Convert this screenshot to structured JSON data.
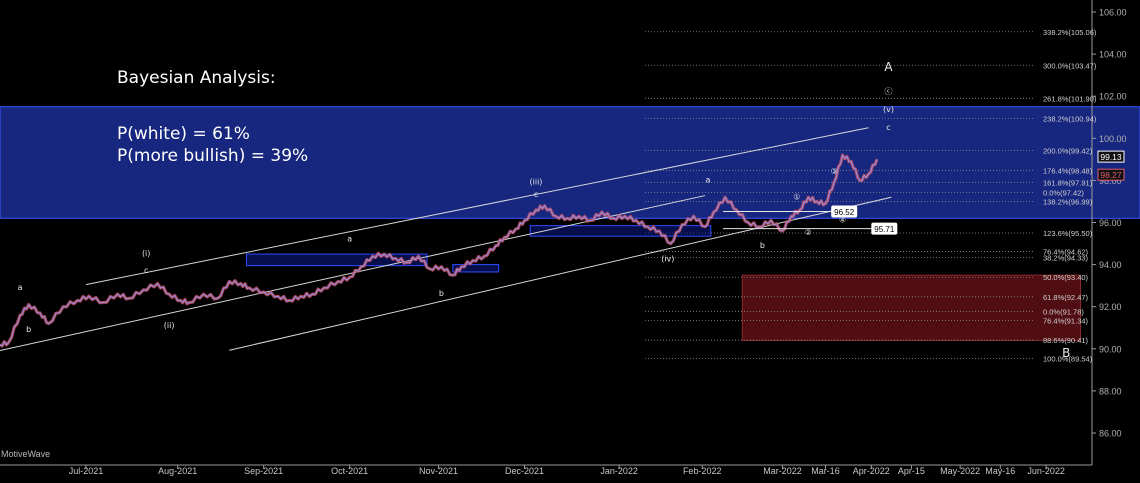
{
  "analysis": {
    "title": "Bayesian Analysis:",
    "p_white": "P(white) = 61%",
    "p_bullish": "P(more bullish) = 39%"
  },
  "watermark": "MotiveWave",
  "chart_data": {
    "type": "line",
    "title": "",
    "x_start": "2021-06-01",
    "x_end": "2022-06-17",
    "x_ticks": [
      {
        "label": "Jul-2021",
        "date": "2021-07-01"
      },
      {
        "label": "Aug-2021",
        "date": "2021-08-02"
      },
      {
        "label": "Sep-2021",
        "date": "2021-09-01"
      },
      {
        "label": "Oct-2021",
        "date": "2021-10-01"
      },
      {
        "label": "Nov-2021",
        "date": "2021-11-01"
      },
      {
        "label": "Dec-2021",
        "date": "2021-12-01"
      },
      {
        "label": "Jan-2022",
        "date": "2022-01-03"
      },
      {
        "label": "Feb-2022",
        "date": "2022-02-01"
      },
      {
        "label": "Mar-2022",
        "date": "2022-03-01"
      },
      {
        "label": "Mar-16",
        "date": "2022-03-16"
      },
      {
        "label": "Apr-2022",
        "date": "2022-04-01"
      },
      {
        "label": "Apr-15",
        "date": "2022-04-15"
      },
      {
        "label": "May-2022",
        "date": "2022-05-02"
      },
      {
        "label": "May-16",
        "date": "2022-05-16"
      },
      {
        "label": "Jun-2022",
        "date": "2022-06-01"
      }
    ],
    "y_ticks": [
      "106.00",
      "104.00",
      "102.00",
      "100.00",
      "98.00",
      "96.00",
      "94.00",
      "92.00",
      "90.00",
      "88.00",
      "86.00"
    ],
    "ylim": [
      85.0,
      106.4
    ],
    "grid": false,
    "price_series": [
      [
        "2021-06-01",
        90.2
      ],
      [
        "2021-06-04",
        90.3
      ],
      [
        "2021-06-08",
        91.6
      ],
      [
        "2021-06-11",
        92.1
      ],
      [
        "2021-06-15",
        91.7
      ],
      [
        "2021-06-18",
        91.2
      ],
      [
        "2021-06-23",
        92.0
      ],
      [
        "2021-06-28",
        92.3
      ],
      [
        "2021-07-02",
        92.5
      ],
      [
        "2021-07-07",
        92.2
      ],
      [
        "2021-07-12",
        92.6
      ],
      [
        "2021-07-16",
        92.4
      ],
      [
        "2021-07-21",
        92.8
      ],
      [
        "2021-07-26",
        93.1
      ],
      [
        "2021-07-30",
        92.6
      ],
      [
        "2021-08-03",
        92.3
      ],
      [
        "2021-08-06",
        92.2
      ],
      [
        "2021-08-11",
        92.6
      ],
      [
        "2021-08-16",
        92.4
      ],
      [
        "2021-08-20",
        93.2
      ],
      [
        "2021-08-24",
        93.1
      ],
      [
        "2021-08-27",
        92.9
      ],
      [
        "2021-09-01",
        92.7
      ],
      [
        "2021-09-06",
        92.5
      ],
      [
        "2021-09-10",
        92.3
      ],
      [
        "2021-09-14",
        92.5
      ],
      [
        "2021-09-18",
        92.6
      ],
      [
        "2021-09-22",
        92.9
      ],
      [
        "2021-09-27",
        93.2
      ],
      [
        "2021-10-01",
        93.4
      ],
      [
        "2021-10-05",
        93.9
      ],
      [
        "2021-10-09",
        94.4
      ],
      [
        "2021-10-13",
        94.5
      ],
      [
        "2021-10-17",
        94.3
      ],
      [
        "2021-10-21",
        94.1
      ],
      [
        "2021-10-25",
        94.4
      ],
      [
        "2021-10-29",
        93.8
      ],
      [
        "2021-11-02",
        93.9
      ],
      [
        "2021-11-06",
        93.5
      ],
      [
        "2021-11-09",
        93.9
      ],
      [
        "2021-11-13",
        94.2
      ],
      [
        "2021-11-17",
        94.4
      ],
      [
        "2021-11-21",
        94.9
      ],
      [
        "2021-11-24",
        95.3
      ],
      [
        "2021-11-28",
        95.7
      ],
      [
        "2021-12-01",
        96.1
      ],
      [
        "2021-12-05",
        96.6
      ],
      [
        "2021-12-08",
        96.8
      ],
      [
        "2021-12-12",
        96.3
      ],
      [
        "2021-12-16",
        96.2
      ],
      [
        "2021-12-20",
        96.3
      ],
      [
        "2021-12-24",
        96.1
      ],
      [
        "2021-12-28",
        96.5
      ],
      [
        "2022-01-01",
        96.2
      ],
      [
        "2022-01-05",
        96.3
      ],
      [
        "2022-01-09",
        96.1
      ],
      [
        "2022-01-13",
        95.8
      ],
      [
        "2022-01-17",
        95.6
      ],
      [
        "2022-01-21",
        95.0
      ],
      [
        "2022-01-25",
        95.9
      ],
      [
        "2022-01-29",
        96.3
      ],
      [
        "2022-02-02",
        95.8
      ],
      [
        "2022-02-05",
        96.5
      ],
      [
        "2022-02-09",
        97.2
      ],
      [
        "2022-02-13",
        96.6
      ],
      [
        "2022-02-17",
        96.0
      ],
      [
        "2022-02-21",
        95.8
      ],
      [
        "2022-02-25",
        96.1
      ],
      [
        "2022-03-01",
        95.6
      ],
      [
        "2022-03-04",
        96.3
      ],
      [
        "2022-03-07",
        96.6
      ],
      [
        "2022-03-10",
        97.2
      ],
      [
        "2022-03-13",
        97.0
      ],
      [
        "2022-03-16",
        96.9
      ],
      [
        "2022-03-19",
        97.9
      ],
      [
        "2022-03-22",
        99.2
      ],
      [
        "2022-03-25",
        98.9
      ],
      [
        "2022-03-28",
        98.0
      ],
      [
        "2022-03-31",
        98.3
      ],
      [
        "2022-04-03",
        99.0
      ]
    ],
    "price_labels": [
      {
        "text": "99.13",
        "value": 99.13,
        "color": "#ffffff"
      },
      {
        "text": "98.27",
        "value": 98.27,
        "color": "#e05a6a"
      }
    ],
    "fib_levels": [
      {
        "label": "338.2%(105.06)",
        "value": 105.06
      },
      {
        "label": "300.0%(103.47)",
        "value": 103.47
      },
      {
        "label": "261.8%(101.90)",
        "value": 101.9
      },
      {
        "label": "238.2%(100.94)",
        "value": 100.94
      },
      {
        "label": "200.0%(99.42)",
        "value": 99.42
      },
      {
        "label": "176.4%(98.48)",
        "value": 98.48
      },
      {
        "label": "161.8%(97.91)",
        "value": 97.91
      },
      {
        "label": "0.0%(97.42)",
        "value": 97.42
      },
      {
        "label": "138.2%(96.99)",
        "value": 96.99
      },
      {
        "label": "123.6%(95.50)",
        "value": 95.5
      },
      {
        "label": "76.4%(94.62)",
        "value": 94.62
      },
      {
        "label": "38.2%(94.33)",
        "value": 94.33
      },
      {
        "label": "50.0%(93.40)",
        "value": 93.4
      },
      {
        "label": "61.8%(92.47)",
        "value": 92.47
      },
      {
        "label": "0.0%(91.78)",
        "value": 91.78
      },
      {
        "label": "76.4%(91.34)",
        "value": 91.34
      },
      {
        "label": "88.6%(90.41)",
        "value": 90.41
      },
      {
        "label": "100.0%(89.54)",
        "value": 89.54
      }
    ],
    "level_tags": [
      {
        "text": "96.52",
        "value": 96.52,
        "date": "2022-03-18"
      },
      {
        "text": "95.71",
        "value": 95.71,
        "date": "2022-04-01"
      }
    ],
    "zones": [
      {
        "name": "blue-target-zone",
        "y1": 96.2,
        "y2": 101.5,
        "color": "#1a2a8c"
      },
      {
        "name": "red-target-zone",
        "y1": 90.4,
        "y2": 93.5,
        "date1": "2022-02-15",
        "date2": "2022-06-13",
        "color": "#5a0f14"
      }
    ],
    "blue_boxes": [
      {
        "date1": "2021-08-26",
        "date2": "2021-10-28",
        "y1": 93.95,
        "y2": 94.5
      },
      {
        "date1": "2021-11-06",
        "date2": "2021-11-22",
        "y1": 93.65,
        "y2": 94.0
      },
      {
        "date1": "2021-12-03",
        "date2": "2022-02-04",
        "y1": 95.35,
        "y2": 95.85
      }
    ],
    "channel_lines": [
      {
        "date1": "2021-07-01",
        "y1": 93.05,
        "date2": "2022-03-31",
        "y2": 100.5
      },
      {
        "date1": "2021-06-01",
        "y1": 89.92,
        "date2": "2022-02-02",
        "y2": 97.28
      },
      {
        "date1": "2021-08-20",
        "y1": 89.93,
        "date2": "2022-04-08",
        "y2": 97.2
      }
    ],
    "wave_labels": [
      {
        "text": "a",
        "date": "2021-06-08",
        "value": 92.8
      },
      {
        "text": "b",
        "date": "2021-06-11",
        "value": 90.8
      },
      {
        "text": "(i)",
        "date": "2021-07-22",
        "value": 94.4
      },
      {
        "text": "c",
        "date": "2021-07-22",
        "value": 93.6
      },
      {
        "text": "(ii)",
        "date": "2021-07-30",
        "value": 91.0
      },
      {
        "text": "a",
        "date": "2021-10-01",
        "value": 95.1
      },
      {
        "text": "b",
        "date": "2021-11-02",
        "value": 92.5
      },
      {
        "text": "(iii)",
        "date": "2021-12-05",
        "value": 97.8
      },
      {
        "text": "c",
        "date": "2021-12-05",
        "value": 97.2
      },
      {
        "text": "(iv)",
        "date": "2022-01-20",
        "value": 94.15
      },
      {
        "text": "a",
        "date": "2022-02-03",
        "value": 97.9
      },
      {
        "text": "b",
        "date": "2022-02-22",
        "value": 94.8
      },
      {
        "text": "①",
        "date": "2022-03-06",
        "value": 97.1
      },
      {
        "text": "②",
        "date": "2022-03-10",
        "value": 95.4
      },
      {
        "text": "③",
        "date": "2022-03-19",
        "value": 98.3
      },
      {
        "text": "④",
        "date": "2022-03-22",
        "value": 96.0
      },
      {
        "text": "A",
        "date": "2022-04-07",
        "value": 103.2
      },
      {
        "text": "ⓒ",
        "date": "2022-04-07",
        "value": 102.1
      },
      {
        "text": "(v)",
        "date": "2022-04-07",
        "value": 101.25
      },
      {
        "text": "c",
        "date": "2022-04-07",
        "value": 100.4
      },
      {
        "text": "B",
        "date": "2022-06-08",
        "value": 89.6
      }
    ]
  }
}
